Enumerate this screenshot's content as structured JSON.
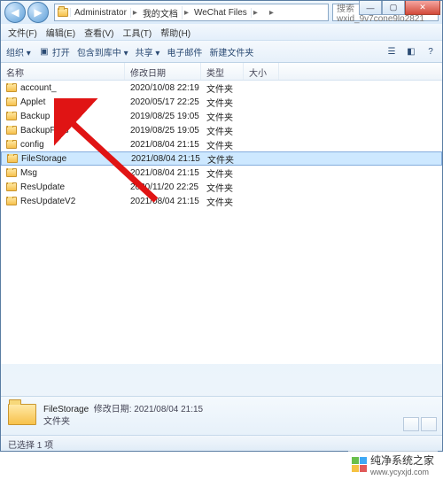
{
  "window": {
    "min": "—",
    "max": "▢",
    "close": "✕"
  },
  "breadcrumb": {
    "segs": [
      "Administrator",
      "我的文档",
      "WeChat Files",
      ""
    ]
  },
  "search": {
    "placeholder": "搜索 wxid_9v7cone9lo2821"
  },
  "menu": {
    "file": "文件(F)",
    "edit": "编辑(E)",
    "view": "查看(V)",
    "tools": "工具(T)",
    "help": "帮助(H)"
  },
  "toolbar": {
    "organize": "组织 ▾",
    "open": "打开",
    "include": "包含到库中 ▾",
    "share": "共享 ▾",
    "email": "电子邮件",
    "newfolder": "新建文件夹"
  },
  "columns": {
    "name": "名称",
    "date": "修改日期",
    "type": "类型",
    "size": "大小"
  },
  "files": [
    {
      "name": "account_",
      "date": "2020/10/08 22:19",
      "type": "文件夹"
    },
    {
      "name": "Applet",
      "date": "2020/05/17 22:25",
      "type": "文件夹"
    },
    {
      "name": "Backup",
      "date": "2019/08/25 19:05",
      "type": "文件夹"
    },
    {
      "name": "BackupFiles",
      "date": "2019/08/25 19:05",
      "type": "文件夹"
    },
    {
      "name": "config",
      "date": "2021/08/04 21:15",
      "type": "文件夹"
    },
    {
      "name": "FileStorage",
      "date": "2021/08/04 21:15",
      "type": "文件夹",
      "selected": true
    },
    {
      "name": "Msg",
      "date": "2021/08/04 21:15",
      "type": "文件夹"
    },
    {
      "name": "ResUpdate",
      "date": "2020/11/20 22:25",
      "type": "文件夹"
    },
    {
      "name": "ResUpdateV2",
      "date": "2021/08/04 21:15",
      "type": "文件夹"
    }
  ],
  "details": {
    "name": "FileStorage",
    "date_label": "修改日期:",
    "date_value": "2021/08/04 21:15",
    "type": "文件夹"
  },
  "status": {
    "text": "已选择 1 项"
  },
  "watermark": {
    "title": "纯净系统之家",
    "url": "www.ycyxjd.com"
  }
}
